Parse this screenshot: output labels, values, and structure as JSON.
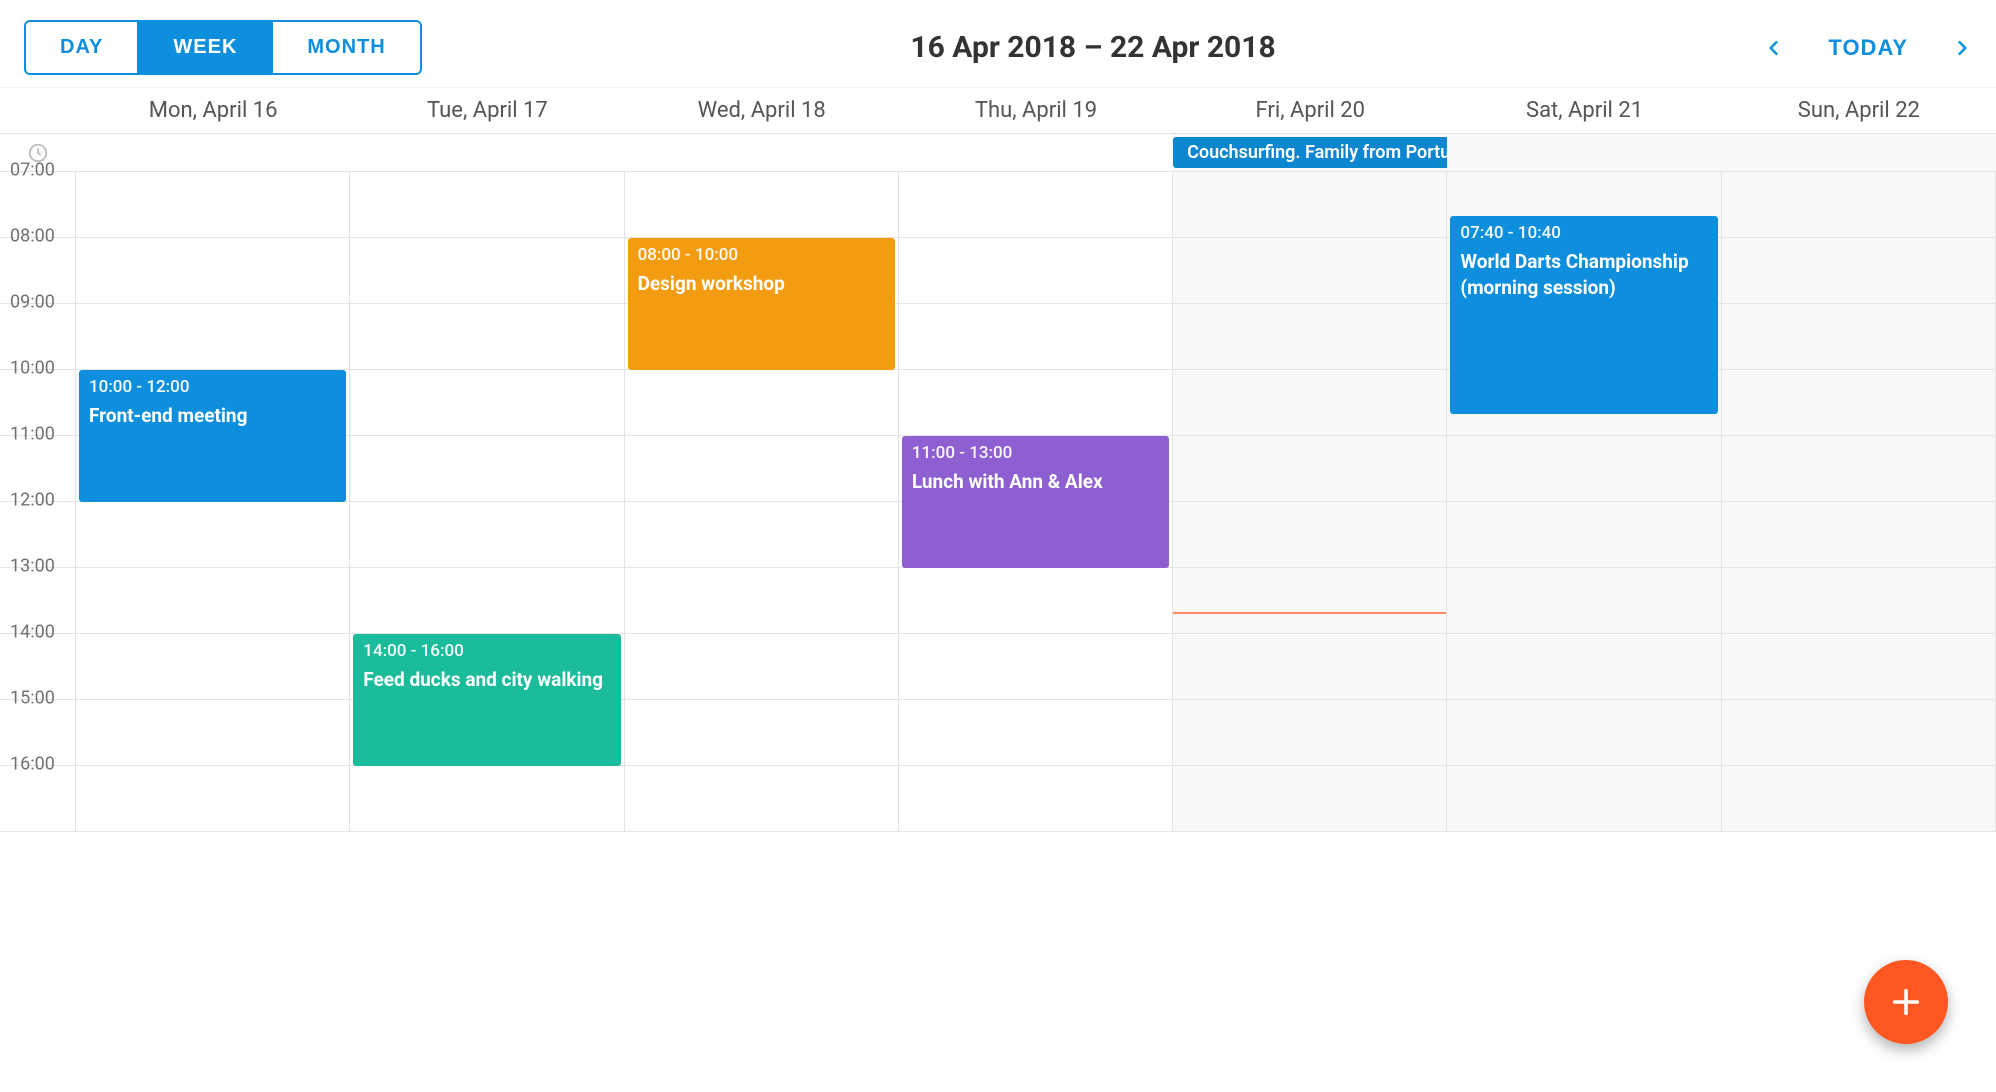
{
  "colors": {
    "brand_blue": "#0e8fde",
    "orange": "#f39c12",
    "teal": "#1abc9c",
    "purple": "#8e5fd0",
    "fab_orange": "#ff5722"
  },
  "toolbar": {
    "views": {
      "day": "DAY",
      "week": "WEEK",
      "month": "MONTH"
    },
    "active_view": "WEEK",
    "range_label": "16 Apr 2018 – 22 Apr 2018",
    "today_label": "TODAY"
  },
  "days": [
    {
      "label": "Mon, April 16",
      "weekend": false
    },
    {
      "label": "Tue, April 17",
      "weekend": false
    },
    {
      "label": "Wed, April 18",
      "weekend": false
    },
    {
      "label": "Thu, April 19",
      "weekend": false
    },
    {
      "label": "Fri, April 20",
      "weekend": true
    },
    {
      "label": "Sat, April 21",
      "weekend": true
    },
    {
      "label": "Sun, April 22",
      "weekend": true
    }
  ],
  "visible_start_hour": 7,
  "visible_end_hour": 16,
  "hours": [
    "07:00",
    "08:00",
    "09:00",
    "10:00",
    "11:00",
    "12:00",
    "13:00",
    "14:00",
    "15:00",
    "16:00"
  ],
  "current_time_marker": {
    "day_index": 4,
    "time": "13:40"
  },
  "allday_events": [
    {
      "day_start": 4,
      "day_end": 7,
      "title": "Couchsurfing. Family from Portugal",
      "color": "#0d86d0"
    }
  ],
  "events": [
    {
      "day_index": 0,
      "start": "10:00",
      "end": "12:00",
      "time_label": "10:00 - 12:00",
      "title": "Front-end meeting",
      "color": "#0e8fde"
    },
    {
      "day_index": 1,
      "start": "14:00",
      "end": "16:00",
      "time_label": "14:00 - 16:00",
      "title": "Feed ducks and city walking",
      "color": "#1abc9c"
    },
    {
      "day_index": 2,
      "start": "08:00",
      "end": "10:00",
      "time_label": "08:00 - 10:00",
      "title": "Design workshop",
      "color": "#f39c12"
    },
    {
      "day_index": 3,
      "start": "11:00",
      "end": "13:00",
      "time_label": "11:00 - 13:00",
      "title": "Lunch with Ann & Alex",
      "color": "#8e5fd0"
    },
    {
      "day_index": 5,
      "start": "07:40",
      "end": "10:40",
      "time_label": "07:40 - 10:40",
      "title": "World Darts Championship (morning session)",
      "color": "#0e8fde"
    }
  ],
  "fab": {
    "icon": "plus-icon"
  }
}
